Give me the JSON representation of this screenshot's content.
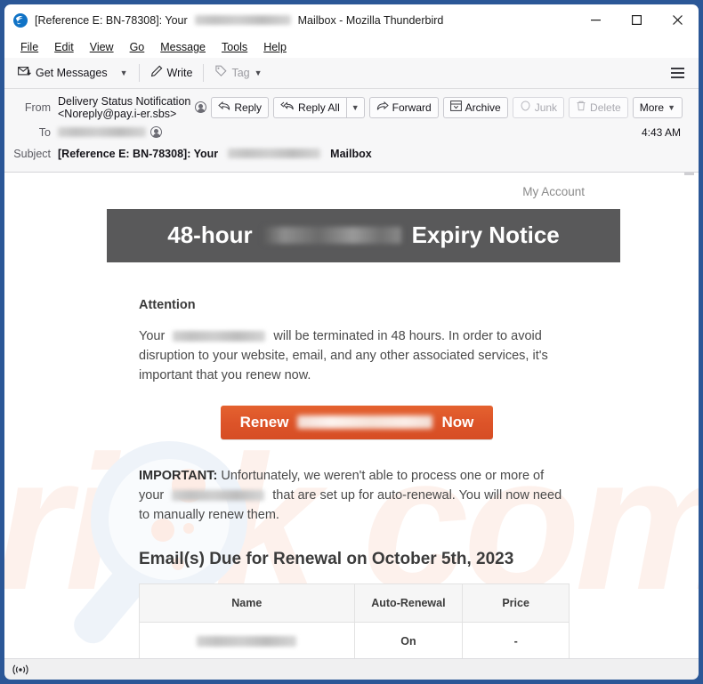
{
  "window": {
    "title_prefix": "[Reference E: BN-78308]: Your",
    "title_suffix": "Mailbox - Mozilla Thunderbird",
    "app_icon": "thunderbird-icon",
    "minimize_label": "minimize-icon",
    "maximize_label": "maximize-icon",
    "close_label": "close-icon"
  },
  "menubar": {
    "items": [
      {
        "label": "File",
        "accel": "F"
      },
      {
        "label": "Edit",
        "accel": "E"
      },
      {
        "label": "View",
        "accel": "V"
      },
      {
        "label": "Go",
        "accel": "G"
      },
      {
        "label": "Message",
        "accel": "M"
      },
      {
        "label": "Tools",
        "accel": "T"
      },
      {
        "label": "Help",
        "accel": "H"
      }
    ]
  },
  "toolbar": {
    "get_messages": "Get Messages",
    "write": "Write",
    "tag": "Tag",
    "app_menu": "app-menu-icon"
  },
  "message_header": {
    "from_label": "From",
    "from_value": "Delivery Status Notification <Noreply@pay.i-er.sbs>",
    "to_label": "To",
    "to_value_redacted": true,
    "subject_label": "Subject",
    "subject_prefix": "[Reference E: BN-78308]: Your",
    "subject_suffix": "Mailbox",
    "time": "4:43 AM",
    "actions": [
      {
        "label": "Reply",
        "icon": "reply-icon",
        "enabled": true
      },
      {
        "label": "Reply All",
        "icon": "reply-all-icon",
        "enabled": true
      },
      {
        "label": "Forward",
        "icon": "forward-icon",
        "enabled": true
      },
      {
        "label": "Archive",
        "icon": "archive-icon",
        "enabled": true
      },
      {
        "label": "Junk",
        "icon": "junk-icon",
        "enabled": false
      },
      {
        "label": "Delete",
        "icon": "trash-icon",
        "enabled": false
      },
      {
        "label": "More",
        "icon": "chevron-down-icon",
        "enabled": true
      }
    ]
  },
  "email": {
    "my_account": "My Account",
    "banner_prefix": "48-hour",
    "banner_suffix": "Expiry Notice",
    "banner_bg": "#59595a",
    "attention_heading": "Attention",
    "paragraph_1_start": "Your",
    "paragraph_1_end": "will be terminated in 48 hours. In order to avoid disruption to your website, email, and any other associated services, it's important that you renew now.",
    "cta_prefix": "Renew",
    "cta_suffix": "Now",
    "cta_color": "#dd5429",
    "important_label": "IMPORTANT:",
    "paragraph_2_start": "Unfortunately, we weren't able to process one or more of your",
    "paragraph_2_end": "that are set up for auto-renewal. You will now need to manually renew them.",
    "due_title": "Email(s) Due for Renewal on October 5th, 2023",
    "table": {
      "headers": [
        "Name",
        "Auto-Renewal",
        "Price"
      ],
      "rows": [
        {
          "name_redacted": true,
          "auto_renewal": "On",
          "price": "-"
        }
      ]
    },
    "watermark_text": "risk com"
  },
  "statusbar": {
    "connection_icon": "online-indicator-icon"
  }
}
